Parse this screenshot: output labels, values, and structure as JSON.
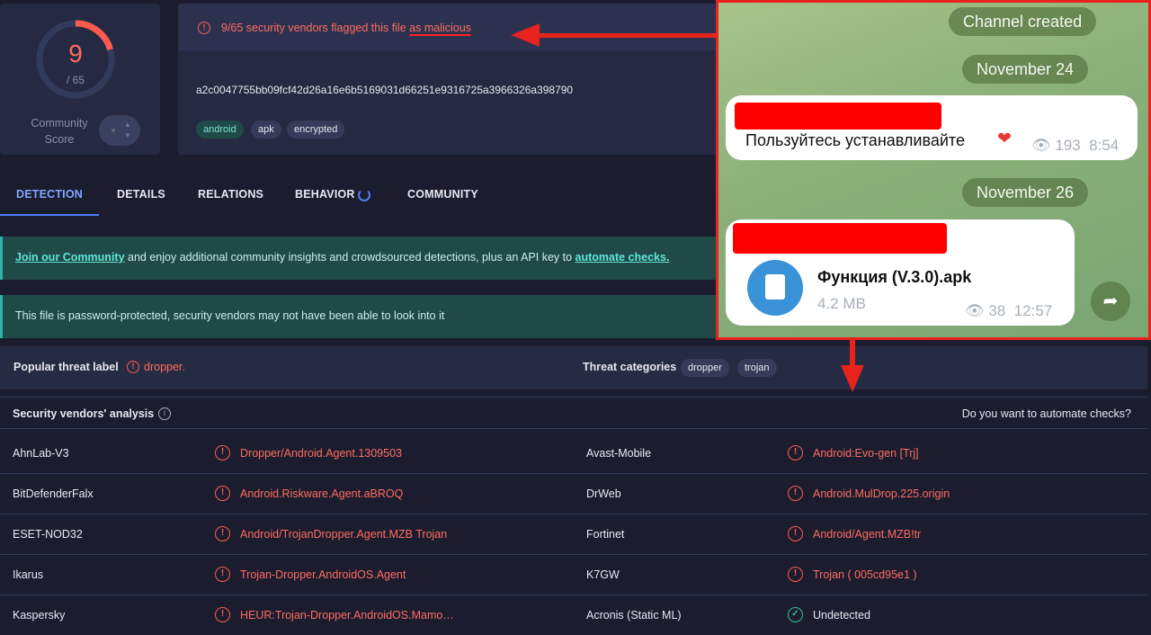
{
  "score": {
    "value": "9",
    "total": "/ 65",
    "community_label": "Community Score"
  },
  "header": {
    "flag_prefix": "9/65 security vendors flagged this file ",
    "flag_emph": "as malicious",
    "hash": "a2c0047755bb09fcf42d26a16e6b5169031d66251e9316725a3966326a398790",
    "tags": [
      "android",
      "apk",
      "encrypted"
    ]
  },
  "tabs": [
    "DETECTION",
    "DETAILS",
    "RELATIONS",
    "BEHAVIOR",
    "COMMUNITY"
  ],
  "banners": {
    "community_link": "Join our Community",
    "community_mid": " and enjoy additional community insights and crowdsourced detections, plus an API key to ",
    "community_link2": "automate checks.",
    "password": "This file is password-protected, security vendors may not have been able to look into it"
  },
  "threat": {
    "label": "Popular threat label",
    "value": "dropper.",
    "categories_label": "Threat categories",
    "categories": [
      "dropper",
      "trojan"
    ]
  },
  "vendors_section": {
    "title": "Security vendors' analysis",
    "automate_question": "Do you want to automate checks?"
  },
  "vendors": [
    {
      "left_name": "AhnLab-V3",
      "left_result": "Dropper/Android.Agent.1309503",
      "right_name": "Avast-Mobile",
      "right_result": "Android:Evo-gen [Trj]",
      "right_status": "malicious"
    },
    {
      "left_name": "BitDefenderFalx",
      "left_result": "Android.Riskware.Agent.aBROQ",
      "right_name": "DrWeb",
      "right_result": "Android.MulDrop.225.origin",
      "right_status": "malicious"
    },
    {
      "left_name": "ESET-NOD32",
      "left_result": "Android/TrojanDropper.Agent.MZB Trojan",
      "right_name": "Fortinet",
      "right_result": "Android/Agent.MZB!tr",
      "right_status": "malicious"
    },
    {
      "left_name": "Ikarus",
      "left_result": "Trojan-Dropper.AndroidOS.Agent",
      "right_name": "K7GW",
      "right_result": "Trojan ( 005cd95e1 )",
      "right_status": "malicious"
    },
    {
      "left_name": "Kaspersky",
      "left_result": "HEUR:Trojan-Dropper.AndroidOS.Mamo…",
      "right_name": "Acronis (Static ML)",
      "right_result": "Undetected",
      "right_status": "undetected"
    }
  ],
  "telegram": {
    "pill_created": "Channel created",
    "pill_nov24": "November 24",
    "pill_nov26": "November 26",
    "msg1_text": "Пользуйтесь устанавливайте",
    "msg1_views": "193",
    "msg1_time": "8:54",
    "file_name": "Функция (V.3.0).apk",
    "file_size": "4.2 MB",
    "msg2_views": "38",
    "msg2_time": "12:57"
  },
  "colors": {
    "malicious": "#ff6b5e",
    "accent": "#4f7df7",
    "redact": "#ff0000",
    "arrow": "#e8231e"
  }
}
